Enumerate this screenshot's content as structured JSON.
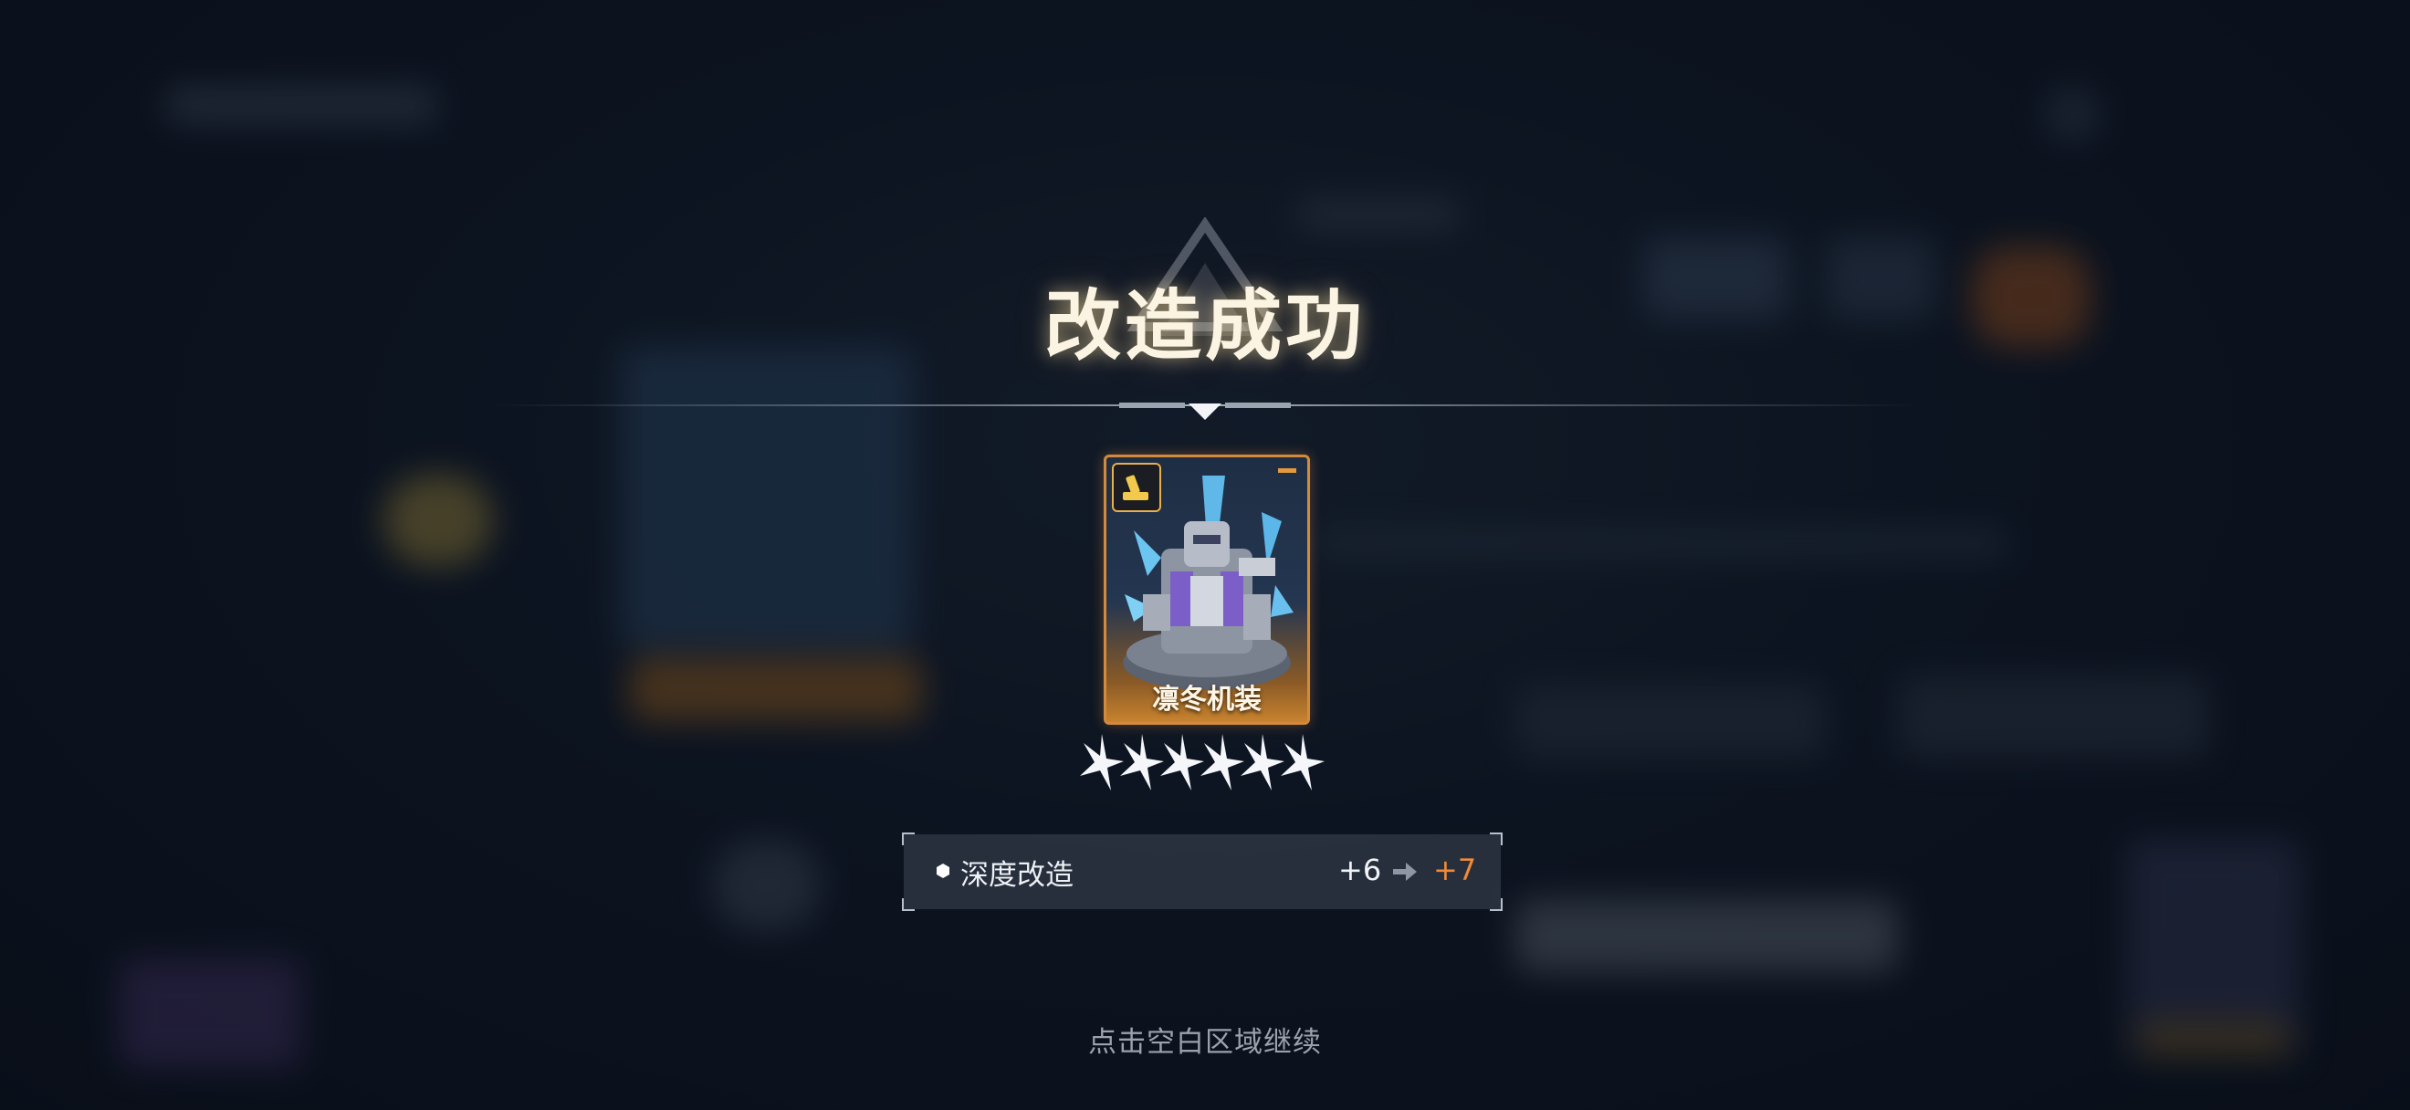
{
  "result": {
    "title": "改造成功"
  },
  "card": {
    "name": "凛冬机装",
    "stars": 6,
    "border_color": "#d48a3c"
  },
  "upgrade": {
    "label": "深度改造",
    "old_value": "+6",
    "new_value": "+7",
    "new_value_color": "#ef8a36"
  },
  "hint": "点击空白区域继续",
  "icons": {
    "type_badge": "wrench-icon",
    "arrow": "arrow-right-icon",
    "bullet": "hexagon-bullet-icon"
  }
}
